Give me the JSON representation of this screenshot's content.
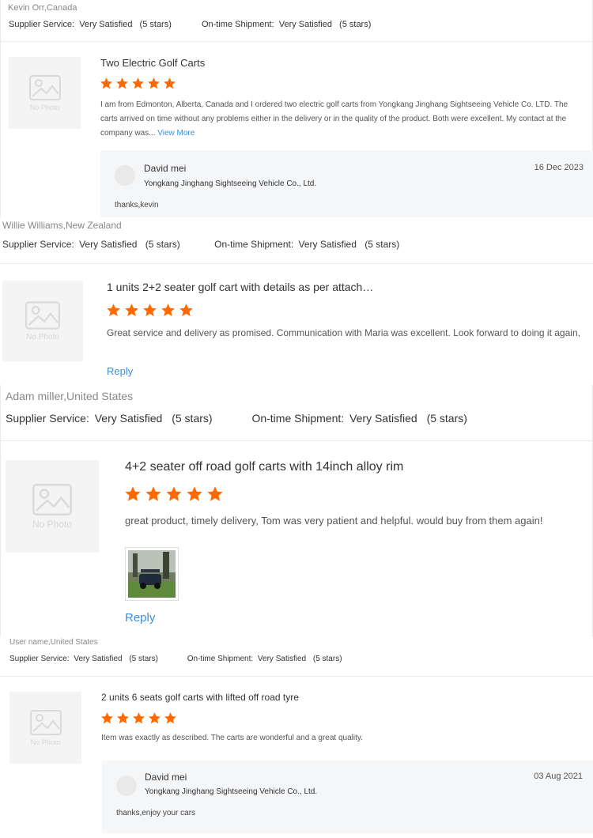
{
  "labels": {
    "supplier_service": "Supplier Service:",
    "ontime_shipment": "On-time Shipment:",
    "no_photo": "No Photo",
    "view_more": "View More",
    "reply": "Reply"
  },
  "reviews": [
    {
      "reviewer": "Kevin Orr,Canada",
      "supplier_rating": "Very Satisfied",
      "supplier_stars": "(5 stars)",
      "shipment_rating": "Very Satisfied",
      "shipment_stars": "(5 stars)",
      "title": "Two Electric Golf Carts",
      "stars": 5,
      "text": "I am from Edmonton, Alberta, Canada and I ordered two electric golf carts from Yongkang Jinghang Sightseeing Vehicle Co. LTD. The carts arrived on time without any problems either in the delivery or in the quality of the product. Both were excellent. My contact at the company was...",
      "reply": {
        "name": "David mei",
        "company": "Yongkang Jinghang Sightseeing Vehicle Co., Ltd.",
        "date": "16 Dec 2023",
        "text": "thanks,kevin"
      }
    },
    {
      "reviewer": "Willie Williams,New Zealand",
      "supplier_rating": "Very Satisfied",
      "supplier_stars": "(5 stars)",
      "shipment_rating": "Very Satisfied",
      "shipment_stars": "(5 stars)",
      "title": "1 units 2+2 seater golf cart with details as per attach…",
      "stars": 5,
      "text": "Great service and delivery as promised. Communication with Maria was excellent. Look forward to doing it again,"
    },
    {
      "reviewer": "Adam miller,United States",
      "supplier_rating": "Very Satisfied",
      "supplier_stars": "(5 stars)",
      "shipment_rating": "Very Satisfied",
      "shipment_stars": "(5 stars)",
      "title": "4+2 seater off road golf carts with 14inch alloy rim",
      "stars": 5,
      "text": "great product, timely delivery, Tom was very patient and helpful. would buy from them again!"
    },
    {
      "reviewer": "User name,United States",
      "supplier_rating": "Very Satisfied",
      "supplier_stars": "(5 stars)",
      "shipment_rating": "Very Satisfied",
      "shipment_stars": "(5 stars)",
      "title": "2 units 6 seats golf carts with lifted off road tyre",
      "stars": 5,
      "text": "Item was exactly as described. The carts are wonderful and a great quality.",
      "reply": {
        "name": "David mei",
        "company": "Yongkang Jinghang Sightseeing Vehicle Co., Ltd.",
        "date": "03 Aug 2021",
        "text": "thanks,enjoy your cars"
      }
    }
  ],
  "colors": {
    "star": "#ff6a00",
    "link": "#3d8fd8",
    "border": "#e6ebf0",
    "reply_bg": "#f5f6f8"
  }
}
